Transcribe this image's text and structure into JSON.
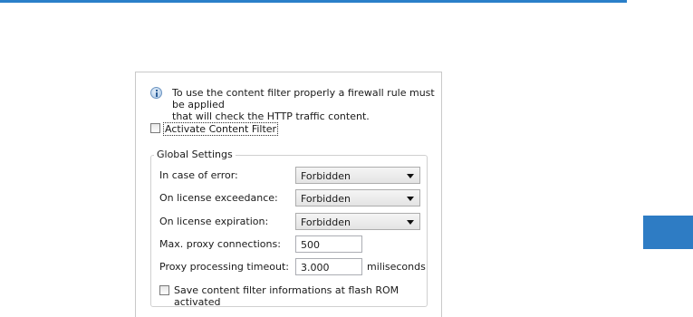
{
  "info": {
    "icon": "info-icon",
    "text_line1": "To use the content filter properly a firewall rule must be applied",
    "text_line2": "that will check the HTTP traffic content."
  },
  "activate": {
    "label": "Activate Content Filter",
    "checked": false
  },
  "global_settings": {
    "title": "Global Settings",
    "error_label": "In case of error:",
    "error_value": "Forbidden",
    "exceedance_label": "On license exceedance:",
    "exceedance_value": "Forbidden",
    "expiration_label": "On license expiration:",
    "expiration_value": "Forbidden",
    "max_proxy_label": "Max. proxy connections:",
    "max_proxy_value": "500",
    "timeout_label": "Proxy processing timeout:",
    "timeout_value": "3.000",
    "timeout_unit": "miliseconds",
    "save_label": "Save content filter informations at flash ROM activated",
    "save_checked": false
  },
  "colors": {
    "accent": "#2a7fc9",
    "side_tab": "#2e7cc4"
  }
}
